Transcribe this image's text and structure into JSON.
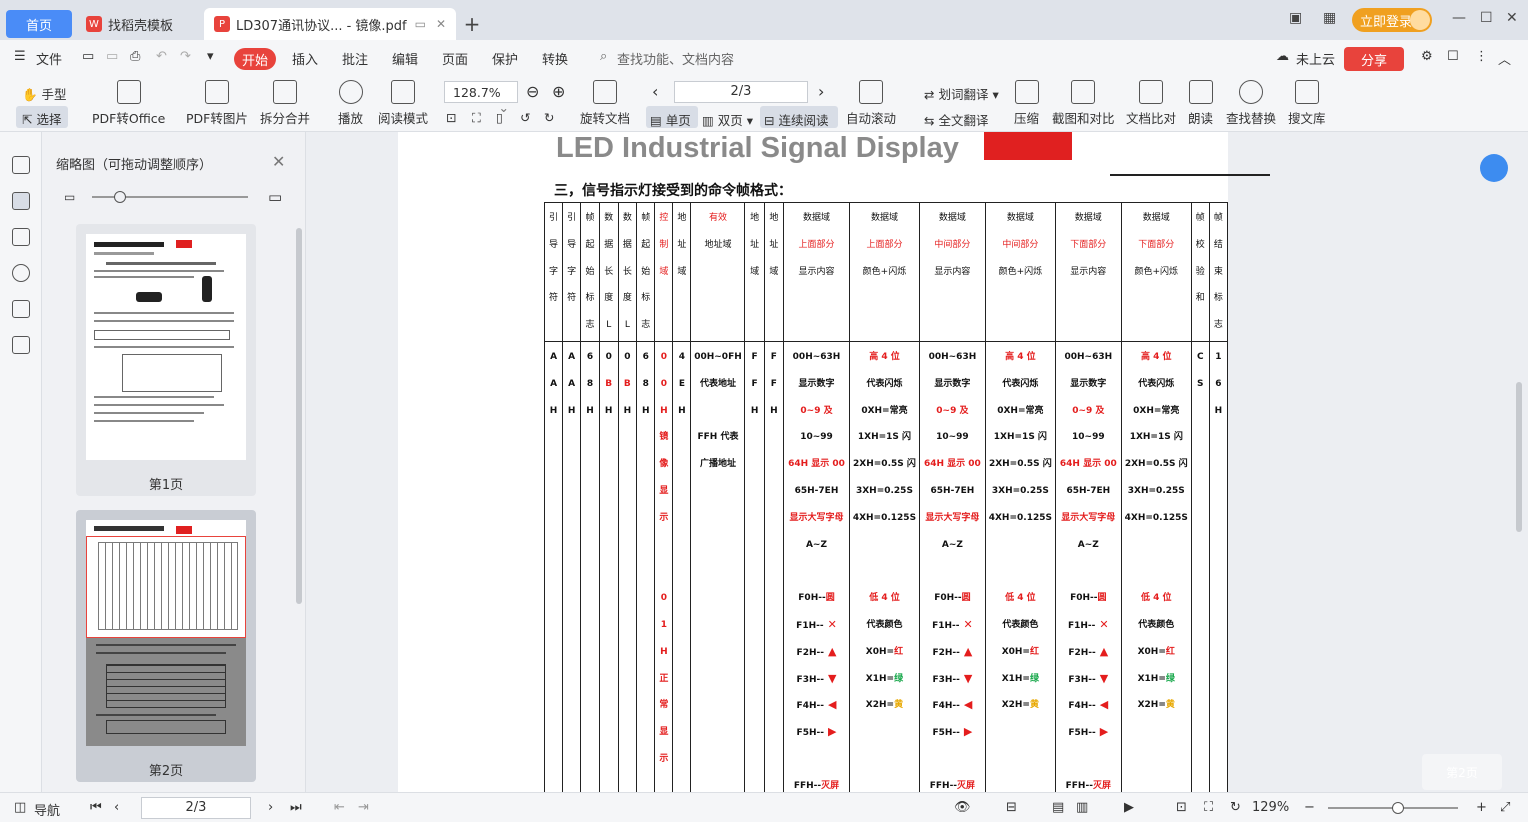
{
  "tabs": {
    "home": "首页",
    "templates": "找稻壳模板",
    "document": "LD307通讯协议... - 镜像.pdf",
    "new_tab": "+"
  },
  "account": {
    "login": "立即登录"
  },
  "menu": {
    "file": "文件",
    "items": [
      "开始",
      "插入",
      "批注",
      "编辑",
      "页面",
      "保护",
      "转换"
    ],
    "search_placeholder": "查找功能、文档内容",
    "cloud": "未上云",
    "share": "分享"
  },
  "toolbar": {
    "hand": "手型",
    "select": "选择",
    "pdf_to_office": "PDF转Office",
    "pdf_to_image": "PDF转图片",
    "split_merge": "拆分合并",
    "play": "播放",
    "read_mode": "阅读模式",
    "zoom": "128.7%",
    "rotate": "旋转文档",
    "page_value": "2/3",
    "single": "单页",
    "double": "双页",
    "continuous": "连续阅读",
    "auto_scroll": "自动滚动",
    "word_translate": "划词翻译",
    "full_translate": "全文翻译",
    "compress": "压缩",
    "screenshot_compare": "截图和对比",
    "doc_compare": "文档比对",
    "read_aloud": "朗读",
    "find_replace": "查找替换",
    "search_library": "搜文库"
  },
  "thumbnails": {
    "title": "缩略图（可拖动调整顺序）",
    "page1": "第1页",
    "page2": "第2页"
  },
  "pdf": {
    "title": "LED Industrial Signal Display",
    "section": "三，信号指示灯接受到的命令帧格式："
  },
  "frame_table": {
    "headers": [
      [
        "引",
        "导",
        "字",
        "符"
      ],
      [
        "引",
        "导",
        "字",
        "符"
      ],
      [
        "帧",
        "起",
        "始",
        "标",
        "志"
      ],
      [
        "数",
        "据",
        "长",
        "度",
        "L"
      ],
      [
        "数",
        "据",
        "长",
        "度",
        "L"
      ],
      [
        "帧",
        "起",
        "始",
        "标",
        "志"
      ],
      [
        "控",
        "制",
        "域"
      ],
      [
        "地",
        "址",
        "域"
      ],
      [
        "有效",
        "地址域"
      ],
      [
        "地",
        "址",
        "域"
      ],
      [
        "地",
        "址",
        "域"
      ],
      [
        "数据域",
        "上面部分",
        "显示内容"
      ],
      [
        "数据域",
        "上面部分",
        "颜色+闪烁"
      ],
      [
        "数据域",
        "中间部分",
        "显示内容"
      ],
      [
        "数据域",
        "中间部分",
        "颜色+闪烁"
      ],
      [
        "数据域",
        "下面部分",
        "显示内容"
      ],
      [
        "数据域",
        "下面部分",
        "颜色+闪烁"
      ],
      [
        "帧",
        "校",
        "验",
        "和"
      ],
      [
        "帧",
        "结",
        "束",
        "标",
        "志"
      ]
    ],
    "row": [
      [
        "A",
        "A",
        "H"
      ],
      [
        "A",
        "A",
        "H"
      ],
      [
        "6",
        "8",
        "H"
      ],
      [
        "0",
        "B",
        "H"
      ],
      [
        "0",
        "B",
        "H"
      ],
      [
        "6",
        "8",
        "H"
      ],
      [
        "0",
        "0",
        "H",
        "镜",
        "像",
        "显",
        "示",
        "",
        "",
        "0",
        "1",
        "H",
        "正",
        "常",
        "显",
        "示"
      ],
      [
        "4",
        "E",
        "H"
      ],
      [
        "00H~0FH",
        "代表地址",
        "",
        "FFH 代表",
        "广播地址"
      ],
      [
        "F",
        "F",
        "H"
      ],
      [
        "F",
        "F",
        "H"
      ],
      [
        "00H~63H",
        "显示数字",
        "0~9 及",
        "10~99",
        "64H 显示 00",
        "65H-7EH",
        "显示大写字母",
        "A~Z",
        "",
        "F0H--圆",
        "F1H--✕",
        "F2H--▲",
        "F3H--▼",
        "F4H--◀",
        "F5H--▶",
        "",
        "FFH--灭屏"
      ],
      [
        "高 4 位",
        "代表闪烁",
        "0XH=常亮",
        "1XH=1S 闪",
        "2XH=0.5S 闪",
        "3XH=0.25S",
        "4XH=0.125S",
        "",
        "",
        "低 4 位",
        "代表颜色",
        "X0H=红",
        "X1H=绿",
        "X2H=黄"
      ],
      [
        "00H~63H",
        "显示数字",
        "0~9 及",
        "10~99",
        "64H 显示 00",
        "65H-7EH",
        "显示大写字母",
        "A~Z",
        "",
        "F0H--圆",
        "F1H--✕",
        "F2H--▲",
        "F3H--▼",
        "F4H--◀",
        "F5H--▶",
        "",
        "FFH--灭屏"
      ],
      [
        "高 4 位",
        "代表闪烁",
        "0XH=常亮",
        "1XH=1S 闪",
        "2XH=0.5S 闪",
        "3XH=0.25S",
        "4XH=0.125S",
        "",
        "",
        "低 4 位",
        "代表颜色",
        "X0H=红",
        "X1H=绿",
        "X2H=黄"
      ],
      [
        "00H~63H",
        "显示数字",
        "0~9 及",
        "10~99",
        "64H 显示 00",
        "65H-7EH",
        "显示大写字母",
        "A~Z",
        "",
        "F0H--圆",
        "F1H--✕",
        "F2H--▲",
        "F3H--▼",
        "F4H--◀",
        "F5H--▶",
        "",
        "FFH--灭屏"
      ],
      [
        "高 4 位",
        "代表闪烁",
        "0XH=常亮",
        "1XH=1S 闪",
        "2XH=0.5S 闪",
        "3XH=0.25S",
        "4XH=0.125S",
        "",
        "",
        "低 4 位",
        "代表颜色",
        "X0H=红",
        "X1H=绿",
        "X2H=黄"
      ],
      [
        "C",
        "S"
      ],
      [
        "1",
        "6",
        "H"
      ]
    ]
  },
  "status": {
    "nav": "导航",
    "page": "2/3",
    "zoom": "129%",
    "ghost_button": "第2页"
  },
  "colors": {
    "accent_red": "#e8433c",
    "accent_blue": "#4a8cf7",
    "login_orange": "#f0a020"
  }
}
